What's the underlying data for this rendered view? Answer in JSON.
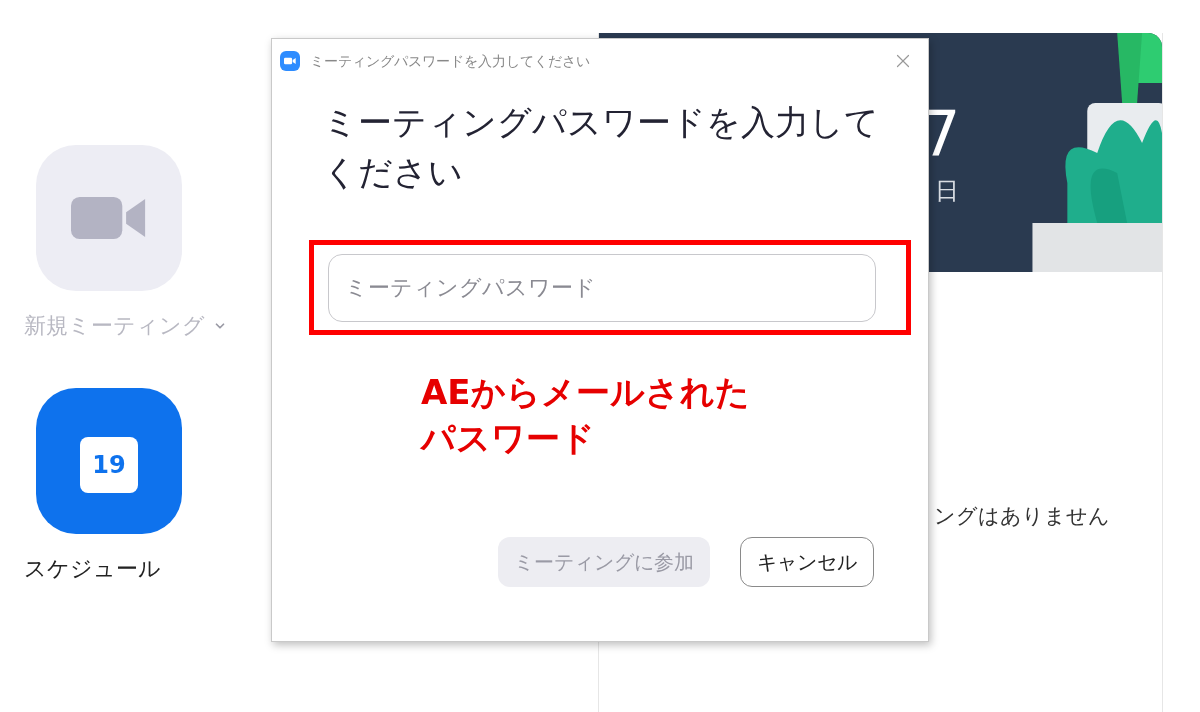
{
  "sidebar": {
    "items": [
      {
        "kind": "video",
        "label": "新規ミーティング",
        "has_menu": true,
        "disabled": true
      },
      {
        "kind": "calendar",
        "label": "スケジュール",
        "icon_text": "19",
        "has_menu": false,
        "disabled": false
      }
    ]
  },
  "clock": {
    "time": "7",
    "date": "日"
  },
  "meetings": {
    "empty_text": "ングはありません"
  },
  "dialog": {
    "title": "ミーティングパスワードを入力してください",
    "heading": "ミーティングパスワードを入力してください",
    "field": {
      "placeholder": "ミーティングパスワード"
    },
    "buttons": [
      {
        "label": "ミーティングに参加",
        "kind": "primary",
        "disabled": true
      },
      {
        "label": "キャンセル",
        "kind": "secondary",
        "disabled": false
      }
    ]
  },
  "annotation": {
    "lines": [
      "AEからメールされた",
      "パスワード"
    ]
  }
}
